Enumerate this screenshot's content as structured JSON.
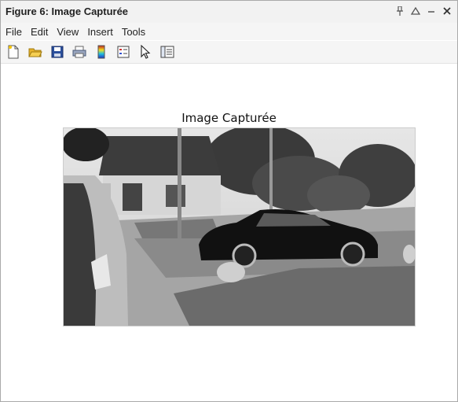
{
  "window": {
    "title": "Figure 6: Image Capturée"
  },
  "menubar": {
    "items": [
      "File",
      "Edit",
      "View",
      "Insert",
      "Tools"
    ]
  },
  "toolbar": {
    "icons": [
      "new-figure-icon",
      "open-folder-icon",
      "save-icon",
      "print-icon",
      "colorbar-icon",
      "legend-icon",
      "pointer-arrow-icon",
      "property-inspector-icon"
    ]
  },
  "axes": {
    "title": "Image Capturée"
  }
}
